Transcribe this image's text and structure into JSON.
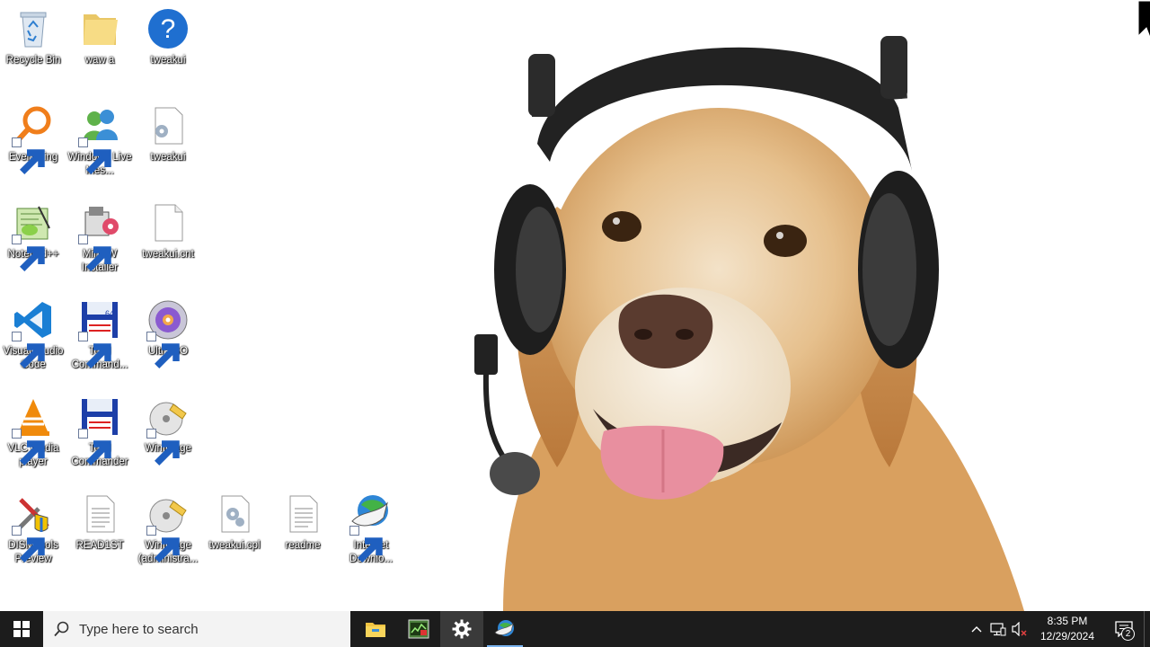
{
  "desktop": {
    "icons": [
      {
        "label": "Recycle Bin",
        "icon": "recycle-bin-icon"
      },
      {
        "label": "waw a",
        "icon": "folder-icon"
      },
      {
        "label": "tweakui",
        "icon": "help-icon"
      },
      {
        "label": "Everything",
        "icon": "everything-search-icon"
      },
      {
        "label": "Windows Live Mes...",
        "icon": "windows-live-messenger-icon"
      },
      {
        "label": "tweakui",
        "icon": "settings-file-icon"
      },
      {
        "label": "Notepad++",
        "icon": "notepad-plus-plus-icon"
      },
      {
        "label": "MinGW Installer",
        "icon": "mingw-installer-icon"
      },
      {
        "label": "tweakui.cnt",
        "icon": "blank-file-icon"
      },
      {
        "label": "Visual Studio Code",
        "icon": "vscode-icon"
      },
      {
        "label": "Total Command...",
        "icon": "total-commander-64-icon"
      },
      {
        "label": "UltraISO",
        "icon": "ultraiso-icon"
      },
      {
        "label": "VLC media player",
        "icon": "vlc-icon"
      },
      {
        "label": "Total Commander",
        "icon": "total-commander-icon"
      },
      {
        "label": "WinImage",
        "icon": "winimage-icon"
      },
      {
        "label": "DISMTools Preview",
        "icon": "dismtools-icon"
      },
      {
        "label": "READ1ST",
        "icon": "text-file-icon"
      },
      {
        "label": "WinImage (administra...",
        "icon": "winimage-admin-icon"
      },
      {
        "label": "tweakui.cpl",
        "icon": "control-panel-file-icon"
      },
      {
        "label": "readme",
        "icon": "text-file-icon"
      },
      {
        "label": "Internet Downlo...",
        "icon": "internet-download-manager-icon"
      }
    ]
  },
  "taskbar": {
    "search_placeholder": "Type here to search",
    "pinned": [
      {
        "name": "File Explorer",
        "icon": "file-explorer-icon"
      },
      {
        "name": "Task Manager",
        "icon": "task-manager-icon"
      },
      {
        "name": "Settings",
        "icon": "settings-gear-icon",
        "active": true
      },
      {
        "name": "Internet Download Manager",
        "icon": "internet-download-manager-icon",
        "running": true
      }
    ],
    "clock": {
      "time": "8:35 PM",
      "date": "12/29/2024"
    },
    "notification_count": "2"
  }
}
